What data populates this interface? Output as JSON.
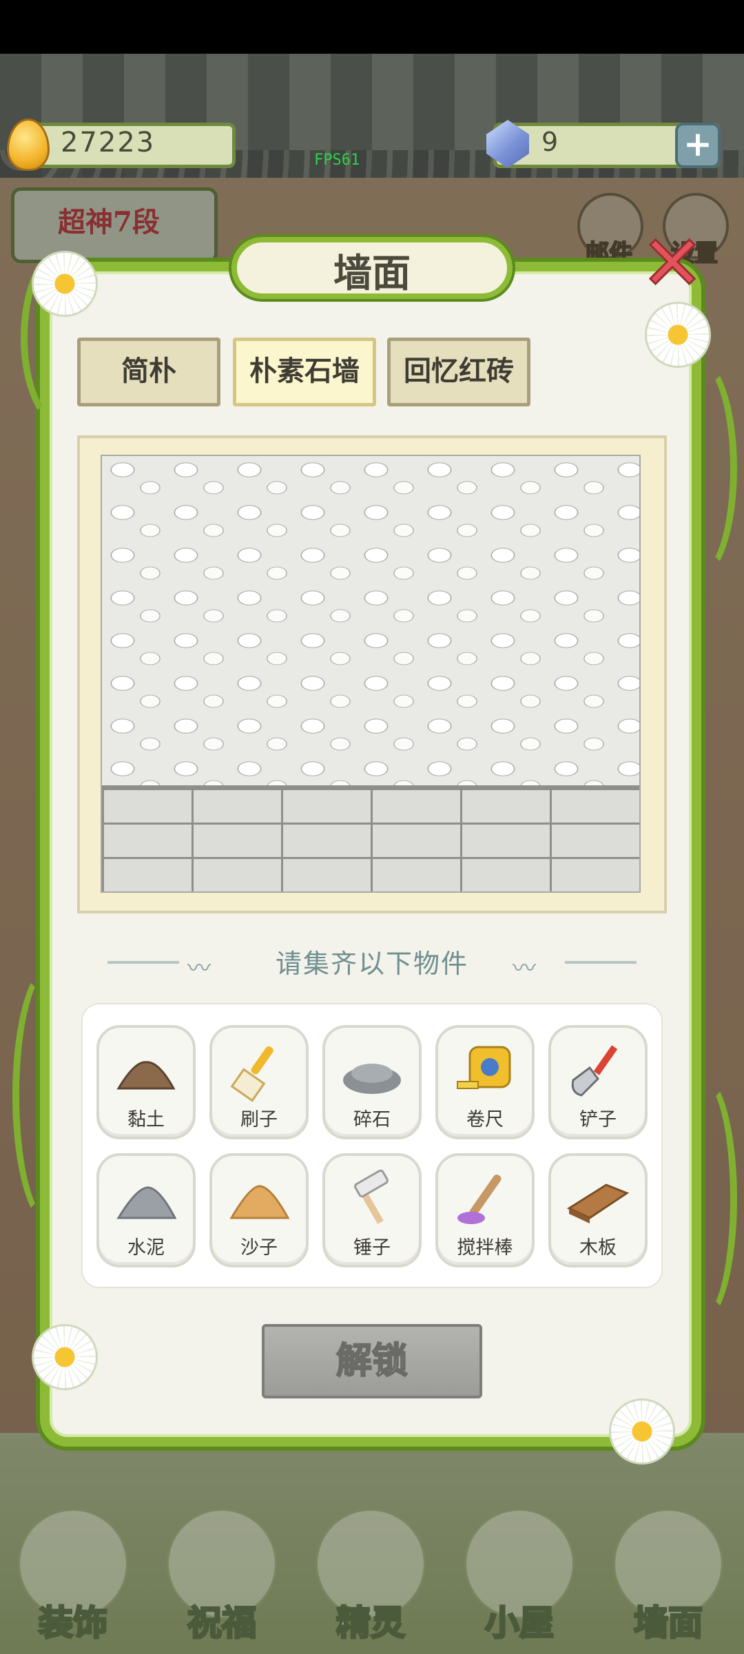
{
  "top_bar": {
    "coins": "27223",
    "fps": "FPS61",
    "gems": "9",
    "plus_label": "+"
  },
  "rank": {
    "label": "超神7段"
  },
  "side_buttons": {
    "mail": "邮件",
    "settings": "设置"
  },
  "modal": {
    "title": "墙面",
    "close_label": "✕",
    "tabs": [
      {
        "label": "简朴",
        "active": false
      },
      {
        "label": "朴素石墙",
        "active": true
      },
      {
        "label": "回忆红砖",
        "active": false
      }
    ],
    "collect_title": "请集齐以下物件",
    "items": [
      {
        "label": "黏土",
        "icon": "clay-icon",
        "color": "#8a6a4a"
      },
      {
        "label": "刷子",
        "icon": "brush-icon",
        "color": "#f0b82a"
      },
      {
        "label": "碎石",
        "icon": "gravel-icon",
        "color": "#8a9094"
      },
      {
        "label": "卷尺",
        "icon": "tape-measure-icon",
        "color": "#f2bf2c"
      },
      {
        "label": "铲子",
        "icon": "shovel-icon",
        "color": "#d94434"
      },
      {
        "label": "水泥",
        "icon": "cement-icon",
        "color": "#9aa0a6"
      },
      {
        "label": "沙子",
        "icon": "sand-icon",
        "color": "#e3aa62"
      },
      {
        "label": "锤子",
        "icon": "hammer-icon",
        "color": "#e7c59a"
      },
      {
        "label": "搅拌棒",
        "icon": "stir-stick-icon",
        "color": "#b070d8"
      },
      {
        "label": "木板",
        "icon": "wood-plank-icon",
        "color": "#b57a43"
      }
    ],
    "unlock_label": "解锁"
  },
  "bottom_nav": [
    {
      "label": "装饰",
      "icon": "plant-icon"
    },
    {
      "label": "祝福",
      "icon": "butterfly-icon"
    },
    {
      "label": "精灵",
      "icon": "fairy-icon"
    },
    {
      "label": "小屋",
      "icon": "house-icon"
    },
    {
      "label": "墙面",
      "icon": "wall-icon"
    }
  ]
}
